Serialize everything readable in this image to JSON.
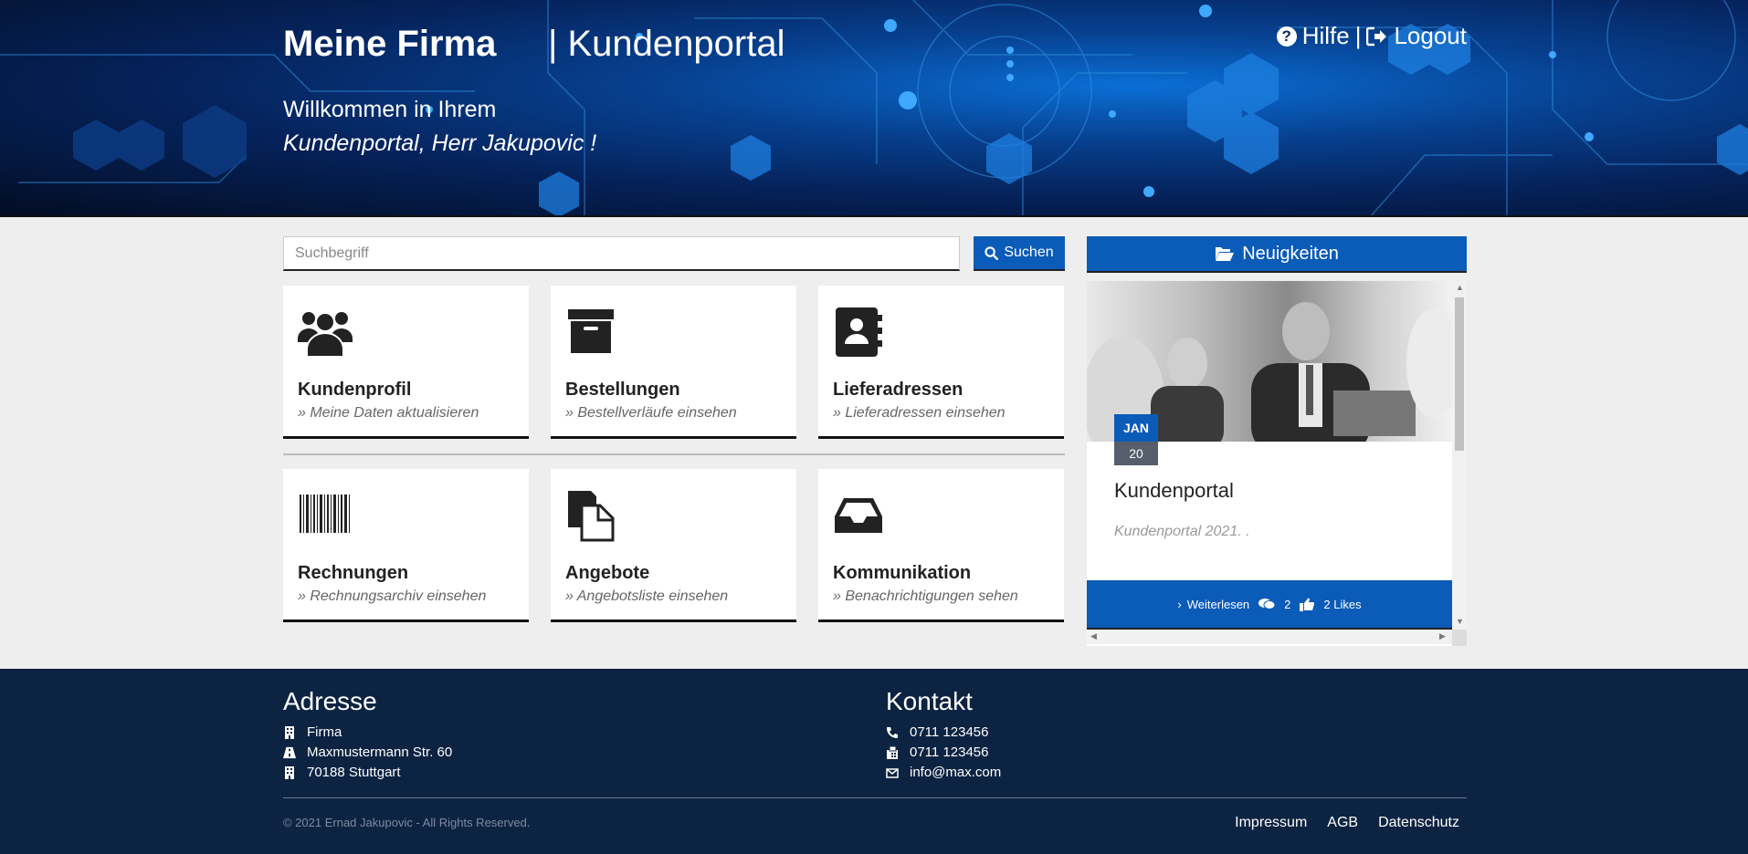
{
  "header": {
    "brand": "Meine Firma",
    "brand_sub": "| Kundenportal",
    "welcome_line1": "Willkommen in Ihrem",
    "welcome_line2": "Kundenportal, Herr Jakupovic !",
    "help_label": "Hilfe",
    "separator": "|",
    "logout_label": "Logout"
  },
  "search": {
    "placeholder": "Suchbegriff",
    "button_label": "Suchen"
  },
  "tiles": [
    {
      "title": "Kundenprofil",
      "subtitle": "» Meine Daten aktualisieren",
      "icon": "users-icon"
    },
    {
      "title": "Bestellungen",
      "subtitle": "» Bestellverläufe einsehen",
      "icon": "archive-box-icon"
    },
    {
      "title": "Lieferadressen",
      "subtitle": "» Lieferadressen einsehen",
      "icon": "address-book-icon"
    },
    {
      "title": "Rechnungen",
      "subtitle": "» Rechnungsarchiv einsehen",
      "icon": "barcode-icon"
    },
    {
      "title": "Angebote",
      "subtitle": "» Angebotsliste einsehen",
      "icon": "documents-icon"
    },
    {
      "title": "Kommunikation",
      "subtitle": "» Benachrichtigungen sehen",
      "icon": "inbox-icon"
    }
  ],
  "news": {
    "header_label": "Neuigkeiten",
    "item": {
      "month": "JAN",
      "day": "20",
      "title": "Kundenportal",
      "text": "Kundenportal 2021. .",
      "read_more": "Weiterlesen",
      "comments": "2",
      "likes": "2 Likes"
    }
  },
  "footer": {
    "address_title": "Adresse",
    "address_lines": [
      "Firma",
      "Maxmustermann Str. 60",
      "70188 Stuttgart"
    ],
    "contact_title": "Kontakt",
    "phone": "0711 123456",
    "fax": "0711 123456",
    "email": "info@max.com",
    "copyright": "© 2021 Ernad Jakupovic - All Rights Reserved.",
    "links": [
      "Impressum",
      "AGB",
      "Datenschutz"
    ]
  },
  "colors": {
    "accent": "#0b5bb8",
    "footer_bg": "#0d2342",
    "page_bg": "#eeeeee"
  }
}
